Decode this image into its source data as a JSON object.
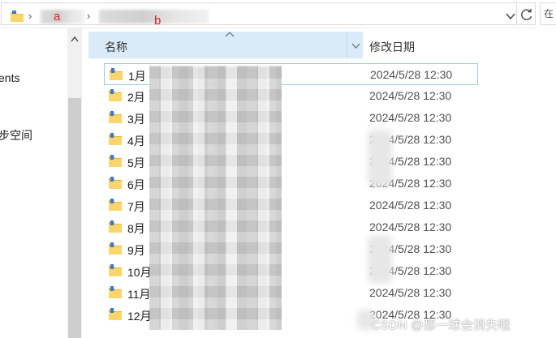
{
  "address_bar": {
    "crumb_a_marker": "a",
    "crumb_b_marker": "b",
    "separator": "›"
  },
  "search": {
    "placeholder": "在"
  },
  "nav_pane": {
    "items": [
      {
        "label": "ents"
      },
      {
        "label": "步空间"
      }
    ]
  },
  "columns": {
    "name": "名称",
    "date_modified": "修改日期"
  },
  "files": [
    {
      "name": "1月",
      "date": "2024/5/28 12:30"
    },
    {
      "name": "2月",
      "date": "2024/5/28 12:30"
    },
    {
      "name": "3月",
      "date": "2024/5/28 12:30"
    },
    {
      "name": "4月",
      "date": "2024/5/28 12:30"
    },
    {
      "name": "5月",
      "date": "2024/5/28 12:30"
    },
    {
      "name": "6月",
      "date": "2024/5/28 12:30"
    },
    {
      "name": "7月",
      "date": "2024/5/28 12:30"
    },
    {
      "name": "8月",
      "date": "2024/5/28 12:30"
    },
    {
      "name": "9月",
      "date": "2024/5/28 12:30"
    },
    {
      "name": "10月",
      "date": "2024/5/28 12:30"
    },
    {
      "name": "11月",
      "date": "2024/5/28 12:30"
    },
    {
      "name": "12月",
      "date": "2024/5/28 12:30"
    }
  ],
  "watermark": "CSDN @那一球会消失哦",
  "colors": {
    "header_highlight": "#d9ebf9",
    "selection_border": "#99c9ef",
    "folder_yellow": "#f4c550",
    "marker_red": "#e02020"
  },
  "icons": {
    "breadcrumb": "folder-icon",
    "dropdown": "chevron-down-icon",
    "refresh": "refresh-icon",
    "sort": "chevron-up-icon",
    "row": "folder-icon"
  }
}
